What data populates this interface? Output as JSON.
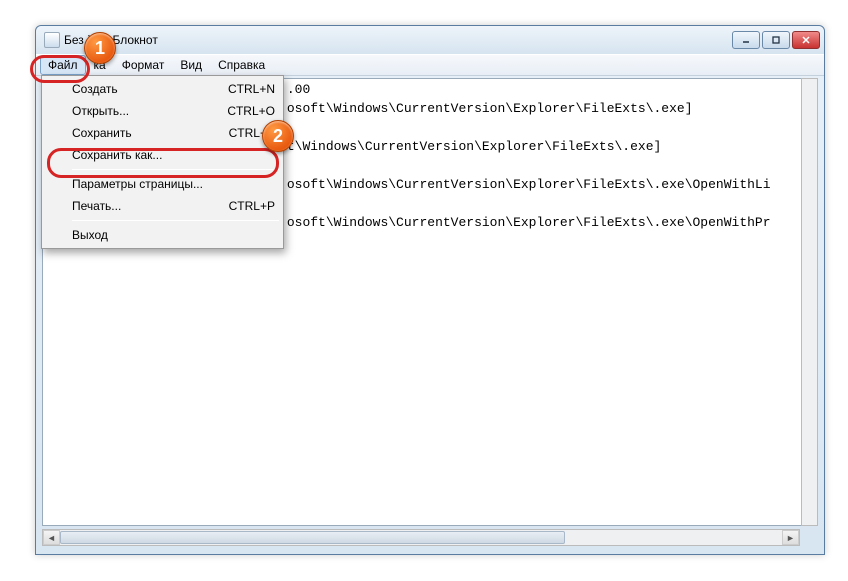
{
  "window": {
    "title": "Без               й — Блокнот"
  },
  "menubar": {
    "file": "Файл",
    "edit": "ка",
    "format": "Формат",
    "view": "Вид",
    "help": "Справка"
  },
  "filemenu": {
    "new": {
      "label": "Создать",
      "shortcut": "CTRL+N"
    },
    "open": {
      "label": "Открыть...",
      "shortcut": "CTRL+O"
    },
    "save": {
      "label": "Сохранить",
      "shortcut": "CTRL+S"
    },
    "saveas": {
      "label": "Сохранить как...",
      "shortcut": ""
    },
    "pagesetup": {
      "label": "Параметры страницы...",
      "shortcut": ""
    },
    "print": {
      "label": "Печать...",
      "shortcut": "CTRL+P"
    },
    "exit": {
      "label": "Выход",
      "shortcut": ""
    }
  },
  "editor": {
    "line1": "                               .00",
    "line2": "                               osoft\\Windows\\CurrentVersion\\Explorer\\FileExts\\.exe]",
    "line3": "                               t\\Windows\\CurrentVersion\\Explorer\\FileExts\\.exe]",
    "line4": "                               osoft\\Windows\\CurrentVersion\\Explorer\\FileExts\\.exe\\OpenWithLi",
    "line5": "                               osoft\\Windows\\CurrentVersion\\Explorer\\FileExts\\.exe\\OpenWithPr"
  },
  "badges": {
    "one": "1",
    "two": "2"
  }
}
